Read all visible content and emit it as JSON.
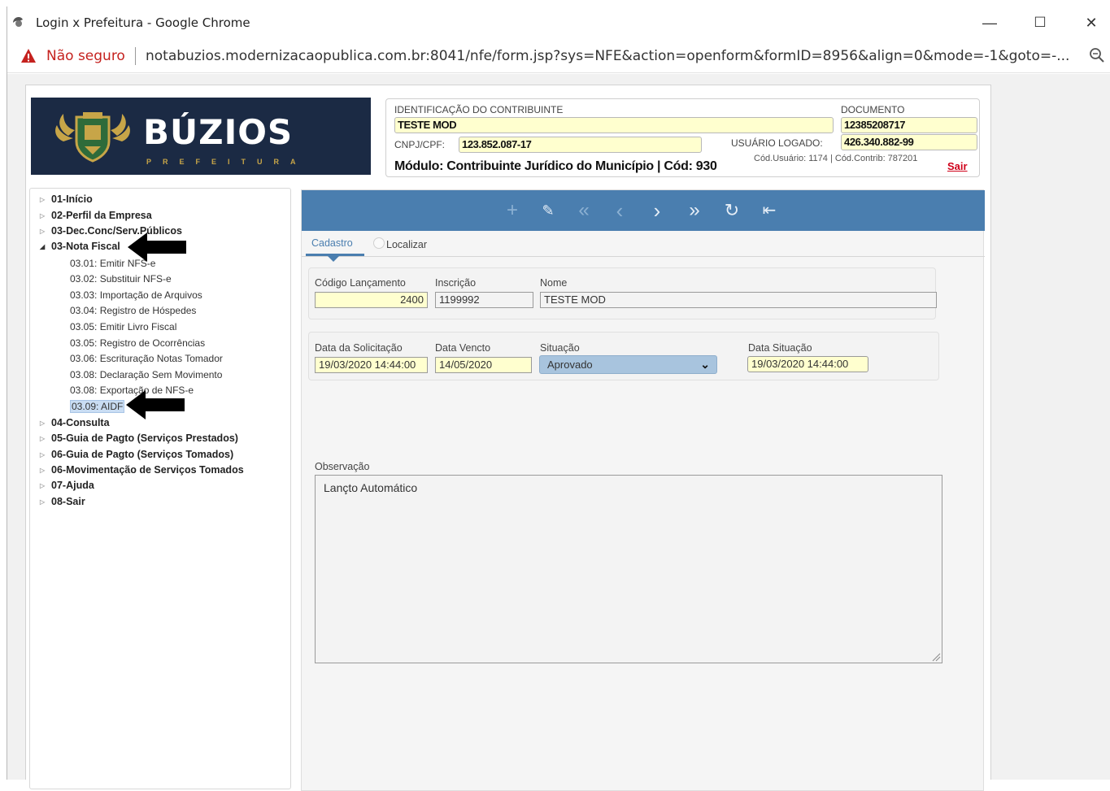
{
  "window": {
    "title": "Login x Prefeitura - Google Chrome",
    "minimize": "—",
    "maximize": "☐",
    "close": "✕"
  },
  "address": {
    "security": "Não seguro",
    "url": "notabuzios.modernizacaopublica.com.br:8041/nfe/form.jsp?sys=NFE&action=openform&formID=8956&align=0&mode=-1&goto=-..."
  },
  "logo": {
    "brand": "BÚZIOS",
    "subtitle": "PREFEITURA"
  },
  "contribuinte": {
    "id_label": "IDENTIFICAÇÃO DO CONTRIBUINTE",
    "id_value": "TESTE MOD",
    "doc_label": "DOCUMENTO",
    "doc_value": "12385208717",
    "cnpj_label": "CNPJ/CPF:",
    "cnpj_value": "123.852.087-17",
    "user_label": "USUÁRIO LOGADO:",
    "user_value": "426.340.882-99",
    "modulo": "Módulo: Contribuinte Jurídico do Município | Cód: 930",
    "cod_info": "Cód.Usuário: 1174 | Cód.Contrib: 787201",
    "sair": "Sair"
  },
  "menu": {
    "items": [
      {
        "label": "01-Início"
      },
      {
        "label": "02-Perfil da Empresa"
      },
      {
        "label": "03-Dec.Conc/Serv.Públicos"
      },
      {
        "label": "03-Nota Fiscal"
      },
      {
        "label": "04-Consulta"
      },
      {
        "label": "05-Guia de Pagto (Serviços Prestados)"
      },
      {
        "label": "06-Guia de Pagto (Serviços Tomados)"
      },
      {
        "label": "06-Movimentação de Serviços Tomados"
      },
      {
        "label": "07-Ajuda"
      },
      {
        "label": "08-Sair"
      }
    ],
    "nota_children": [
      {
        "label": "03.01: Emitir NFS-e"
      },
      {
        "label": "03.02: Substituir NFS-e"
      },
      {
        "label": "03.03: Importação de Arquivos"
      },
      {
        "label": "03.04: Registro de Hóspedes"
      },
      {
        "label": "03.05: Emitir Livro Fiscal"
      },
      {
        "label": "03.05: Registro de Ocorrências"
      },
      {
        "label": "03.06: Escrituração Notas Tomador"
      },
      {
        "label": "03.08: Declaração Sem Movimento"
      },
      {
        "label": "03.08: Exportação de NFS-e"
      },
      {
        "label": "03.09: AIDF"
      }
    ]
  },
  "toolbar": {
    "add": "+",
    "edit": "✎",
    "first": "«",
    "prev": "‹",
    "next": "›",
    "last": "»",
    "refresh": "↻",
    "exit": "⇤"
  },
  "tabs": {
    "cadastro": "Cadastro",
    "localizar": "Localizar"
  },
  "form": {
    "codigo_label": "Código Lançamento",
    "codigo_value": "2400",
    "inscricao_label": "Inscrição",
    "inscricao_value": "1199992",
    "nome_label": "Nome",
    "nome_value": "TESTE MOD",
    "data_sol_label": "Data da Solicitação",
    "data_sol_value": "19/03/2020 14:44:00",
    "data_venc_label": "Data Vencto",
    "data_venc_value": "14/05/2020",
    "situacao_label": "Situação",
    "situacao_value": "Aprovado",
    "data_sit_label": "Data Situação",
    "data_sit_value": "19/03/2020 14:44:00",
    "obs_label": "Observação",
    "obs_value": "Lançto Automático"
  },
  "colors": {
    "toolbar": "#4a7eaf",
    "logo_bg": "#1b2a44",
    "highlight_field": "#ffffcf",
    "sair": "#d0021b"
  }
}
